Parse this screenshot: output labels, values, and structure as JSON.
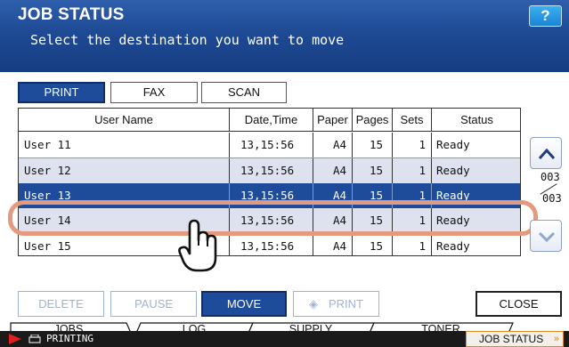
{
  "header": {
    "title": "JOB STATUS",
    "subtitle": "Select the destination you want to move",
    "help_label": "?"
  },
  "type_tabs": [
    {
      "label": "PRINT",
      "active": true
    },
    {
      "label": "FAX",
      "active": false
    },
    {
      "label": "SCAN",
      "active": false
    }
  ],
  "table": {
    "columns": [
      "User Name",
      "Date,Time",
      "Paper",
      "Pages",
      "Sets",
      "Status"
    ],
    "rows": [
      {
        "user": "User 11",
        "datetime": "13,15:56",
        "paper": "A4",
        "pages": "15",
        "sets": "1",
        "status": "Ready"
      },
      {
        "user": "User 12",
        "datetime": "13,15:56",
        "paper": "A4",
        "pages": "15",
        "sets": "1",
        "status": "Ready"
      },
      {
        "user": "User 13",
        "datetime": "13,15:56",
        "paper": "A4",
        "pages": "15",
        "sets": "1",
        "status": "Ready"
      },
      {
        "user": "User 14",
        "datetime": "13,15:56",
        "paper": "A4",
        "pages": "15",
        "sets": "1",
        "status": "Ready"
      },
      {
        "user": "User 15",
        "datetime": "13,15:56",
        "paper": "A4",
        "pages": "15",
        "sets": "1",
        "status": "Ready"
      }
    ],
    "selected_row": "User 13",
    "highlighted_row": "User 14"
  },
  "pagination": {
    "current": "003",
    "total": "003"
  },
  "actions": {
    "delete": "DELETE",
    "pause": "PAUSE",
    "move": "MOVE",
    "print": "PRINT",
    "close": "CLOSE"
  },
  "bottom_tabs": [
    {
      "label": "JOBS",
      "active": true
    },
    {
      "label": "LOG",
      "active": false
    },
    {
      "label": "SUPPLY",
      "active": false
    },
    {
      "label": "TONER",
      "active": false
    }
  ],
  "statusbar": {
    "status_text": "PRINTING",
    "job_status_label": "JOB STATUS",
    "job_status_arrow": "»"
  },
  "colors": {
    "header_blue": "#1e4a94",
    "selected_blue": "#1e4c9a",
    "highlight_salmon": "#e39a7f",
    "status_orange": "#e08a22",
    "play_red": "#e02020"
  },
  "icons": [
    "help-icon",
    "scroll-up-icon",
    "scroll-down-icon",
    "hand-cursor-icon",
    "play-icon",
    "printer-icon",
    "diamond-icon"
  ]
}
